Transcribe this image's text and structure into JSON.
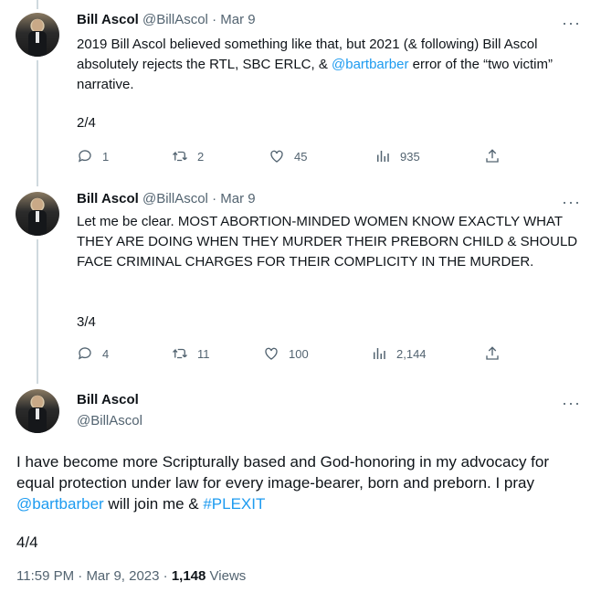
{
  "tweets": [
    {
      "name": "Bill Ascol",
      "handle": "@BillAscol",
      "sep": "·",
      "date": "Mar 9",
      "more": "···",
      "text_before": "2019 Bill Ascol believed something like that, but 2021 (& following) Bill Ascol absolutely rejects the RTL, SBC ERLC, & ",
      "mention": "@bartbarber",
      "text_after": " error of the “two victim” narrative.",
      "counter": "2/4",
      "replies": "1",
      "retweets": "2",
      "likes": "45",
      "views": "935"
    },
    {
      "name": "Bill Ascol",
      "handle": "@BillAscol",
      "sep": "·",
      "date": "Mar 9",
      "more": "···",
      "text": "Let me be clear. MOST ABORTION-MINDED WOMEN KNOW EXACTLY WHAT THEY ARE DOING WHEN THEY MURDER THEIR PREBORN CHILD & SHOULD FACE CRIMINAL CHARGES FOR THEIR COMPLICITY IN THE MURDER.",
      "counter": "3/4",
      "replies": "4",
      "retweets": "11",
      "likes": "100",
      "views": "2,144"
    }
  ],
  "main": {
    "name": "Bill Ascol",
    "handle": "@BillAscol",
    "more": "···",
    "text_before": "I have become more Scripturally based and God-honoring in my advocacy for equal protection under law for every image-bearer, born and preborn. I pray ",
    "mention": "@bartbarber",
    "text_middle": " will join me & ",
    "hashtag": "#PLEXIT",
    "counter": "4/4",
    "time": "11:59 PM",
    "sep": "·",
    "date": "Mar 9, 2023",
    "sep2": "·",
    "views_count": "1,148",
    "views_label": "Views"
  },
  "icons": [
    "reply-icon",
    "retweet-icon",
    "like-icon",
    "views-icon",
    "share-icon"
  ]
}
